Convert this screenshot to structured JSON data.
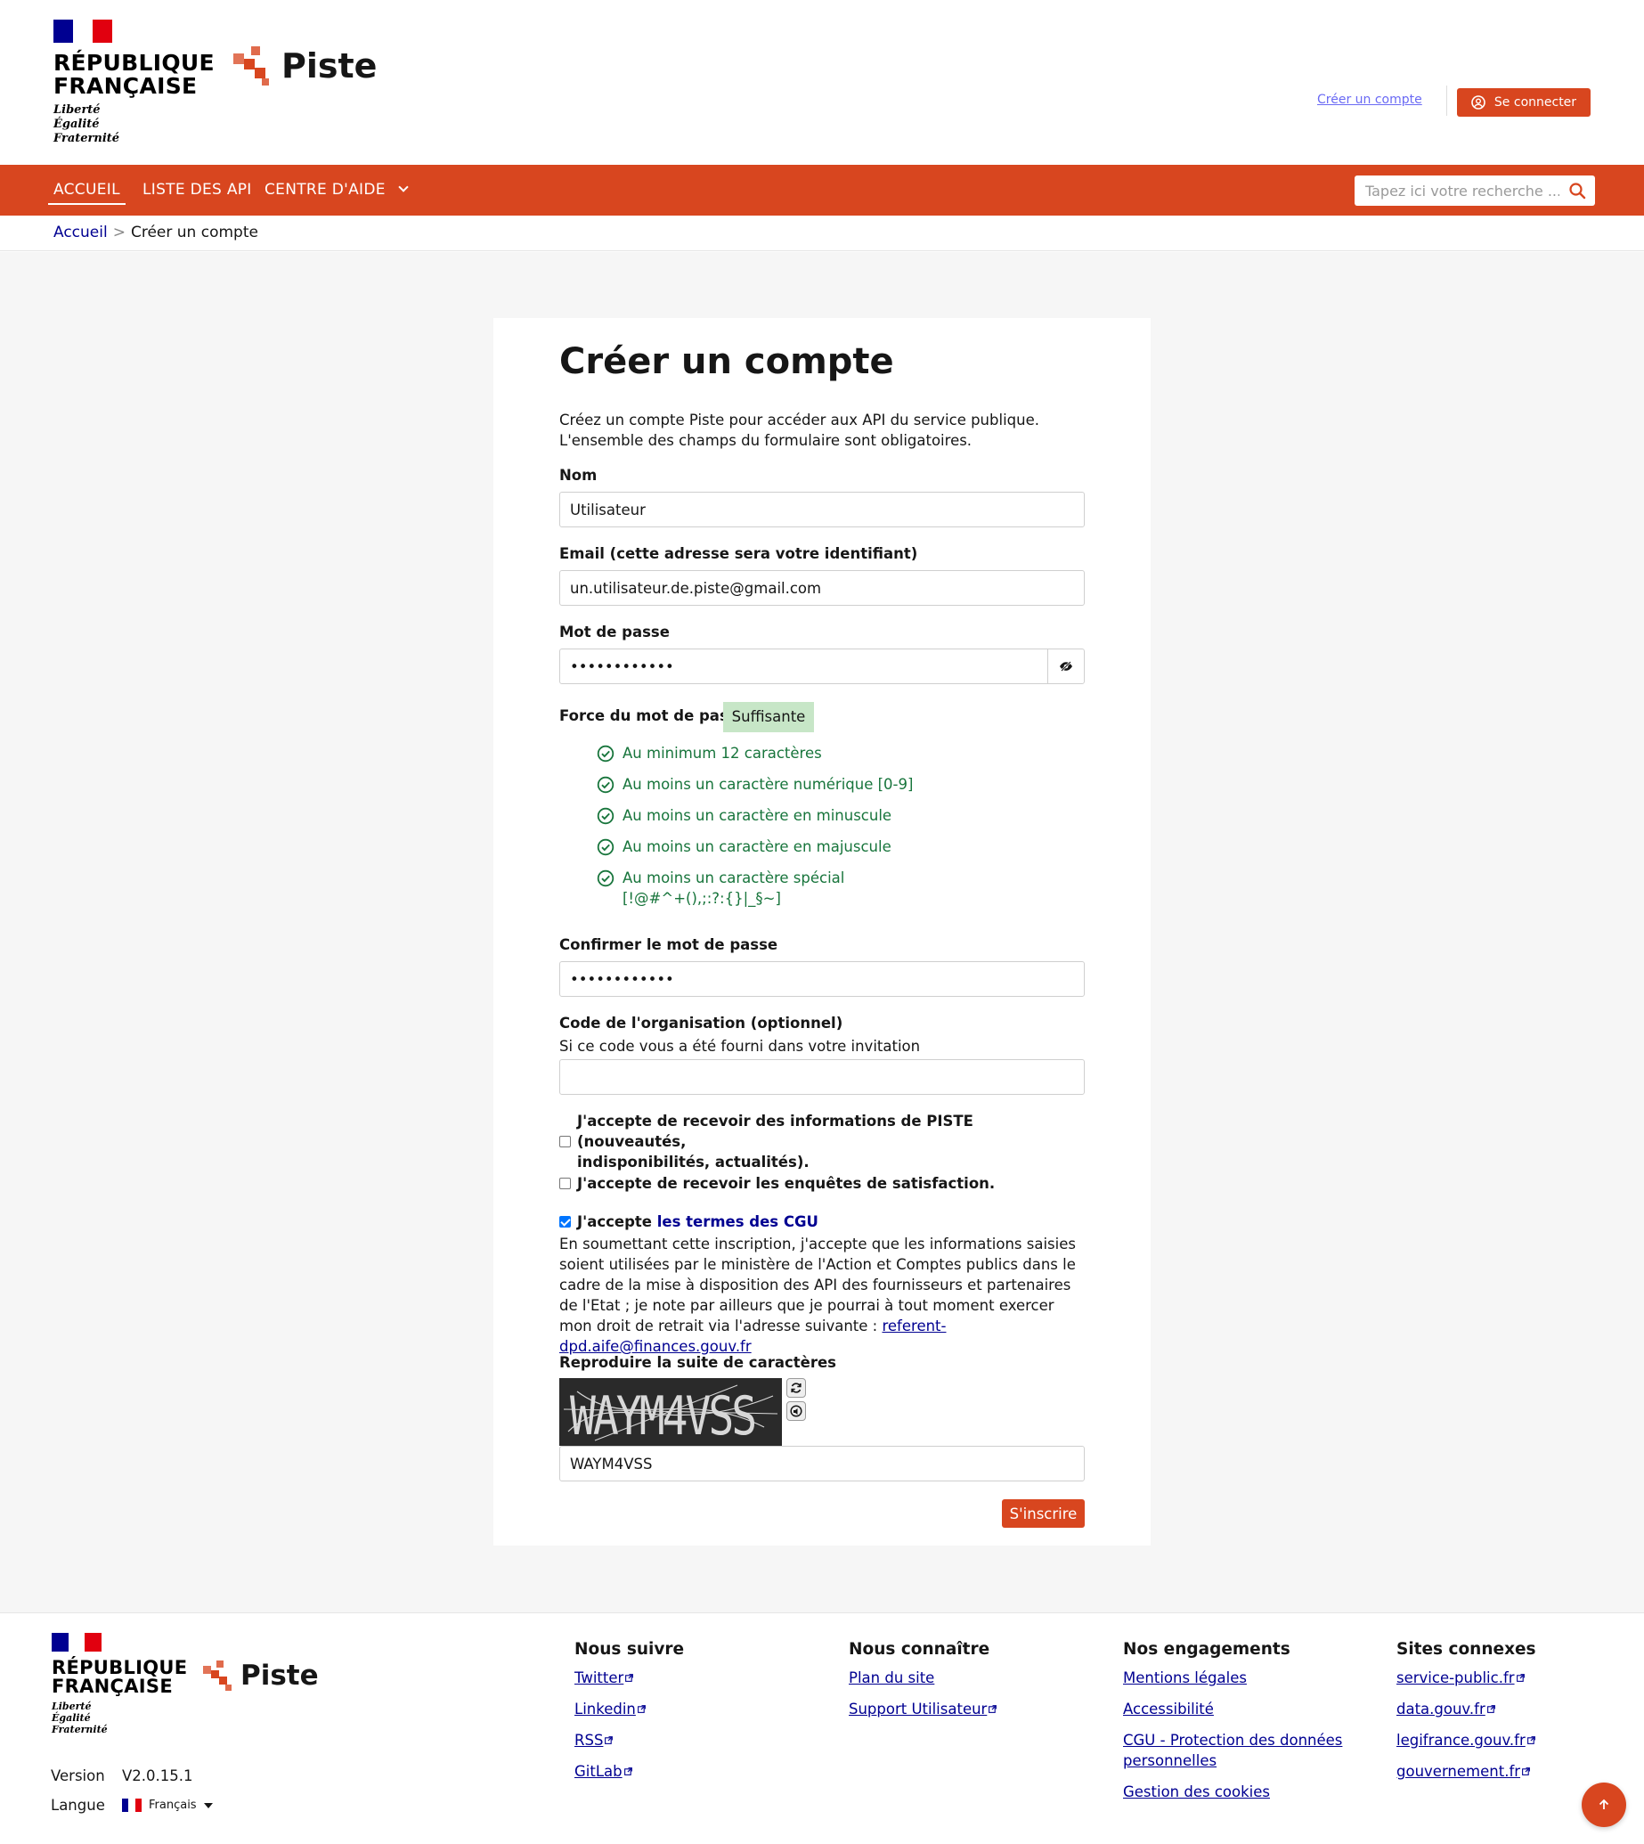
{
  "header": {
    "rf_name_line1": "RÉPUBLIQUE",
    "rf_name_line2": "FRANÇAISE",
    "motto_1": "Liberté",
    "motto_2": "Égalité",
    "motto_3": "Fraternité",
    "brand": "Piste",
    "create_account_link": "Créer un compte",
    "login_button": "Se connecter"
  },
  "nav": {
    "items": [
      {
        "label": "ACCUEIL",
        "active": true
      },
      {
        "label": "LISTE DES API",
        "active": false
      },
      {
        "label": "CENTRE D'AIDE",
        "active": false
      }
    ],
    "search_placeholder": "Tapez ici votre recherche ..."
  },
  "breadcrumb": {
    "home": "Accueil",
    "separator": ">",
    "current": "Créer un compte"
  },
  "form": {
    "title": "Créer un compte",
    "intro_line1": "Créez un compte Piste pour accéder aux API du service publique.",
    "intro_line2": "L'ensemble des champs du formulaire sont obligatoires.",
    "name_label": "Nom",
    "name_value": "Utilisateur",
    "email_label": "Email (cette adresse sera votre identifiant)",
    "email_value": "un.utilisateur.de.piste@gmail.com",
    "password_label": "Mot de passe",
    "password_value": "••••••••••••",
    "strength_label": "Force du mot de passe",
    "strength_value": "Suffisante",
    "rules": [
      "Au minimum 12 caractères",
      "Au moins un caractère numérique [0-9]",
      "Au moins un caractère en minuscule",
      "Au moins un caractère en majuscule",
      "Au moins un caractère spécial"
    ],
    "special_chars": "[!@#^+(),;:?:{}|_§~]",
    "confirm_label": "Confirmer le mot de passe",
    "confirm_value": "••••••••••••",
    "org_label": "Code de l'organisation (optionnel)",
    "org_hint": "Si ce code vous a été fourni dans votre invitation",
    "org_value": "",
    "consent_info_line1": "J'accepte de recevoir des informations de PISTE (nouveautés,",
    "consent_info_line2": "indisponibilités, actualités).",
    "consent_info_checked": false,
    "consent_survey": "J'accepte de recevoir les enquêtes de satisfaction.",
    "consent_survey_checked": false,
    "cgu_prefix": "J'accepte",
    "cgu_link": "les termes des CGU",
    "cgu_checked": true,
    "legal_text_1": "En soumettant cette inscription, j'accepte que les informations saisies soient utilisées par le ministère de l'Action et Comptes publics dans le cadre de la mise à disposition des API des fournisseurs et partenaires de l'Etat ; je note par ailleurs que je pourrai à tout moment exercer mon droit de retrait via l'adresse suivante :",
    "legal_email": "referent-dpd.aife@finances.gouv.fr",
    "captcha_label": "Reproduire la suite de caractères",
    "captcha_image_text": "WAYM4VSS",
    "captcha_value": "WAYM4VSS",
    "submit_button": "S'inscrire"
  },
  "footer": {
    "version_key": "Version",
    "version_value": "V2.0.15.1",
    "lang_key": "Langue",
    "lang_value": "Français",
    "columns": [
      {
        "title": "Nous suivre",
        "links": [
          "Twitter",
          "Linkedin",
          "RSS",
          "GitLab"
        ]
      },
      {
        "title": "Nous connaître",
        "links": [
          "Plan du site",
          "Support Utilisateur"
        ]
      },
      {
        "title": "Nos engagements",
        "links": [
          "Mentions légales",
          "Accessibilité",
          "CGU - Protection des données personnelles",
          "Gestion des cookies"
        ]
      },
      {
        "title": "Sites connexes",
        "links": [
          "service-public.fr",
          "data.gouv.fr",
          "legifrance.gouv.fr",
          "gouvernement.fr"
        ]
      }
    ]
  },
  "colors": {
    "accent": "#d8461f",
    "link": "#000091",
    "success": "#18753c",
    "strength_badge": "#c7e6c7"
  }
}
